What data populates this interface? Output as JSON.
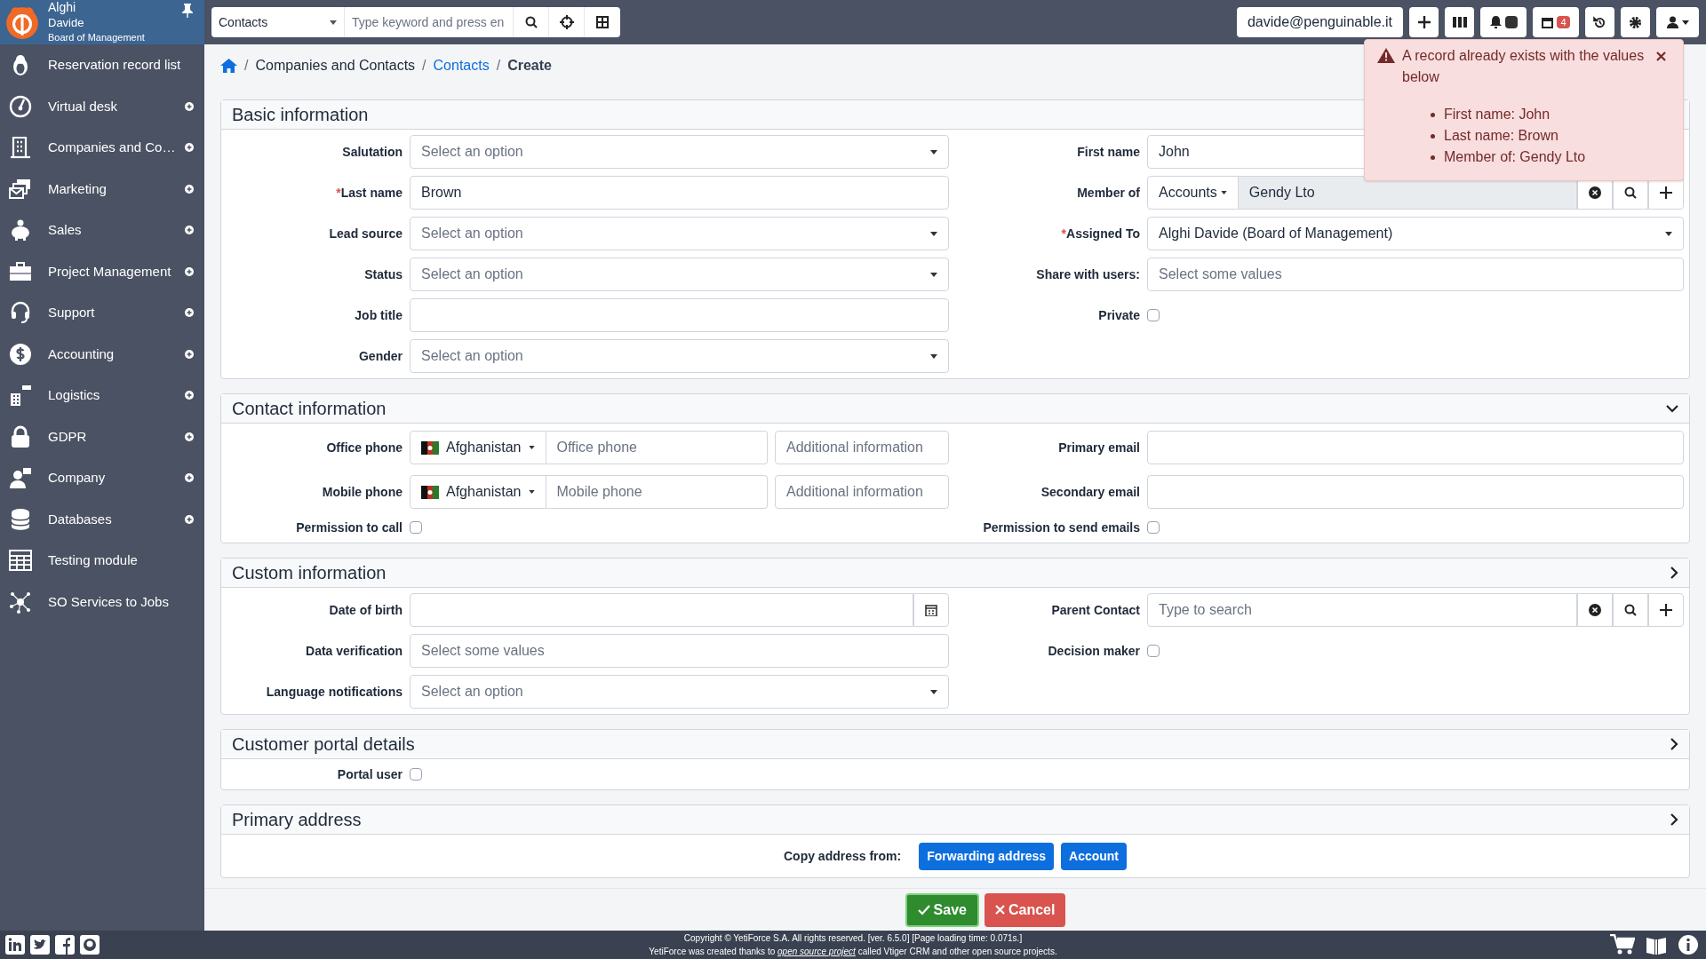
{
  "sidebar": {
    "user": {
      "first_name": "Alghi",
      "last_name": "Davide",
      "role": "Board of Management"
    },
    "items": [
      {
        "label": "Reservation record list",
        "expandable": false
      },
      {
        "label": "Virtual desk",
        "expandable": true
      },
      {
        "label": "Companies and Co…",
        "expandable": true
      },
      {
        "label": "Marketing",
        "expandable": true
      },
      {
        "label": "Sales",
        "expandable": true
      },
      {
        "label": "Project Management",
        "expandable": true
      },
      {
        "label": "Support",
        "expandable": true
      },
      {
        "label": "Accounting",
        "expandable": true
      },
      {
        "label": "Logistics",
        "expandable": true
      },
      {
        "label": "GDPR",
        "expandable": true
      },
      {
        "label": "Company",
        "expandable": true
      },
      {
        "label": "Databases",
        "expandable": true
      },
      {
        "label": "Testing module",
        "expandable": false
      },
      {
        "label": "SO Services to Jobs",
        "expandable": false
      }
    ]
  },
  "topbar": {
    "module": "Contacts",
    "search_placeholder": "Type keyword and press en",
    "email": "davide@penguinable.it",
    "calendar_badge": "4"
  },
  "breadcrumb": [
    {
      "separator": "/",
      "label": "Companies and Contacts",
      "kind": "text"
    },
    {
      "separator": "/",
      "label": "Contacts",
      "kind": "link"
    },
    {
      "separator": "/",
      "label": "Create",
      "kind": "current"
    }
  ],
  "panels": [
    {
      "title": "Basic information",
      "rows": [
        {
          "left": {
            "label": "Salutation",
            "kind": "select",
            "placeholder": "Select an option"
          },
          "right": {
            "label": "First name",
            "kind": "text",
            "value": "John"
          }
        },
        {
          "left": {
            "required_mark": "*",
            "label": "Last name",
            "kind": "text",
            "value": "Brown"
          },
          "right": {
            "label": "Member of",
            "kind": "reference",
            "module": "Accounts",
            "value": "Gendy Lto"
          }
        },
        {
          "left": {
            "label": "Lead source",
            "kind": "select",
            "placeholder": "Select an option"
          },
          "right": {
            "required_mark": "*",
            "label": "Assigned To",
            "kind": "select",
            "value": "Alghi Davide (Board of Management)"
          }
        },
        {
          "left": {
            "label": "Status",
            "kind": "select",
            "placeholder": "Select an option"
          },
          "right": {
            "label": "Share with users:",
            "kind": "multiselect",
            "placeholder": "Select some values"
          }
        },
        {
          "left": {
            "label": "Job title",
            "kind": "text"
          },
          "right": {
            "label": "Private",
            "kind": "checkbox",
            "checked": false
          }
        },
        {
          "left": {
            "label": "Gender",
            "kind": "select",
            "placeholder": "Select an option"
          }
        }
      ]
    },
    {
      "title": "Contact information",
      "expanded": true,
      "rows": [
        {
          "left": {
            "label": "Office phone",
            "kind": "phone",
            "country": "Afghanistan",
            "placeholder": "Office phone",
            "extra_placeholder": "Additional information"
          },
          "right": {
            "label": "Primary email",
            "kind": "text"
          }
        },
        {
          "left": {
            "label": "Mobile phone",
            "kind": "phone",
            "country": "Afghanistan",
            "placeholder": "Mobile phone",
            "extra_placeholder": "Additional information"
          },
          "right": {
            "label": "Secondary email",
            "kind": "text"
          }
        },
        {
          "left": {
            "label": "Permission to call",
            "kind": "checkbox",
            "checked": false
          },
          "right": {
            "label": "Permission to send emails",
            "kind": "checkbox",
            "checked": false
          }
        }
      ]
    },
    {
      "title": "Custom information",
      "expanded": false,
      "rows": [
        {
          "left": {
            "label": "Date of birth",
            "kind": "date"
          },
          "right": {
            "label": "Parent Contact",
            "kind": "reference",
            "placeholder": "Type to search"
          }
        },
        {
          "left": {
            "label": "Data verification",
            "kind": "multiselect",
            "placeholder": "Select some values"
          },
          "right": {
            "label": "Decision maker",
            "kind": "checkbox",
            "checked": false
          }
        },
        {
          "left": {
            "label": "Language notifications",
            "kind": "select",
            "placeholder": "Select an option"
          }
        }
      ]
    },
    {
      "title": "Customer portal details",
      "expanded": false,
      "rows": [
        {
          "left": {
            "label": "Portal user",
            "kind": "checkbox",
            "checked": false
          }
        }
      ]
    },
    {
      "title": "Primary address",
      "expanded": false,
      "copy": {
        "label": "Copy address from:",
        "buttons": [
          "Forwarding address",
          "Account"
        ]
      }
    }
  ],
  "actions": {
    "save": "Save",
    "cancel": "Cancel"
  },
  "alert": {
    "message": "A record already exists with the values below",
    "items": [
      "First name: John",
      "Last name: Brown",
      "Member of: Gendy Lto"
    ]
  },
  "footer": {
    "line_1": "Copyright © YetiForce S.A. All rights reserved. [ver. 6.5.0] [Page loading time: 0.071s.]",
    "line_2_before": "YetiForce was created thanks to",
    "line_2_link": "open source project",
    "line_2_after": "called Vtiger CRM and other open source projects."
  }
}
